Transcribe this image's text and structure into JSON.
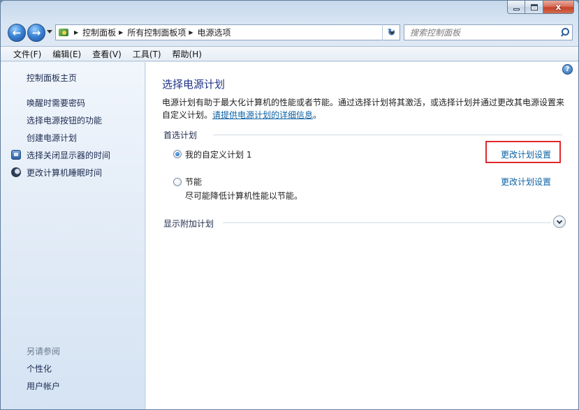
{
  "window": {
    "close_glyph": "x"
  },
  "navbar": {
    "back_glyph": "←",
    "forward_glyph": "→",
    "breadcrumbs": [
      "控制面板",
      "所有控制面板项",
      "电源选项"
    ],
    "refresh_glyph": "↻",
    "search_placeholder": "搜索控制面板"
  },
  "menu": {
    "items": [
      "文件(F)",
      "编辑(E)",
      "查看(V)",
      "工具(T)",
      "帮助(H)"
    ]
  },
  "sidebar": {
    "home": "控制面板主页",
    "links": [
      "唤醒时需要密码",
      "选择电源按钮的功能",
      "创建电源计划",
      "选择关闭显示器的时间",
      "更改计算机睡眠时间"
    ],
    "see_also_title": "另请参阅",
    "see_also": [
      "个性化",
      "用户帐户"
    ]
  },
  "main": {
    "help_glyph": "?",
    "title": "选择电源计划",
    "description": "电源计划有助于最大化计算机的性能或者节能。通过选择计划将其激活，或选择计划并通过更改其电源设置来自定义计划。",
    "description_link": "请提供电源计划的详细信息",
    "description_end": "。",
    "preferred_label": "首选计划",
    "plans": [
      {
        "name": "我的自定义计划 1",
        "description": "",
        "selected": true,
        "change_link": "更改计划设置"
      },
      {
        "name": "节能",
        "description": "尽可能降低计算机性能以节能。",
        "selected": false,
        "change_link": "更改计划设置"
      }
    ],
    "show_more_label": "显示附加计划"
  },
  "colors": {
    "link": "#0b61a4",
    "title": "#1e3287",
    "highlight": "#e0282c"
  }
}
